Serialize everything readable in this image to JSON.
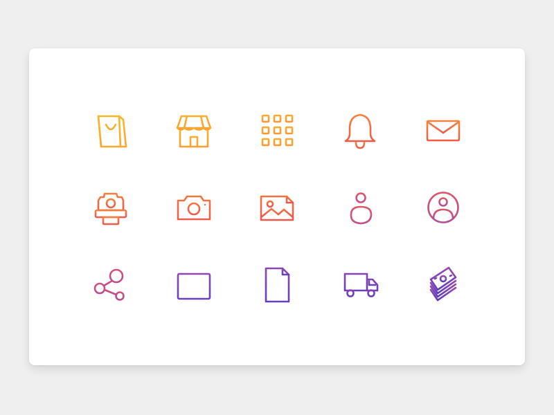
{
  "icons": [
    {
      "name": "shopping-bag-icon",
      "color_top": "#f9b62a",
      "color_bottom": "#f9a92d"
    },
    {
      "name": "store-icon",
      "color_top": "#f9b02c",
      "color_bottom": "#f8a12f"
    },
    {
      "name": "grid-icon",
      "color_top": "#f8ab2e",
      "color_bottom": "#f89a31"
    },
    {
      "name": "bell-icon",
      "color_top": "#f6823a",
      "color_bottom": "#ef5a48"
    },
    {
      "name": "mail-icon",
      "color_top": "#f5843a",
      "color_bottom": "#ee5c47"
    },
    {
      "name": "polaroid-camera-icon",
      "color_top": "#f37f3d",
      "color_bottom": "#ec5a4b"
    },
    {
      "name": "camera-icon",
      "color_top": "#f3763f",
      "color_bottom": "#ec5a4b"
    },
    {
      "name": "image-icon",
      "color_top": "#f27240",
      "color_bottom": "#ea574d"
    },
    {
      "name": "user-icon",
      "color_top": "#dd5664",
      "color_bottom": "#c24f86"
    },
    {
      "name": "user-circle-icon",
      "color_top": "#da5468",
      "color_bottom": "#b54f92"
    },
    {
      "name": "share-icon",
      "color_top": "#d2507a",
      "color_bottom": "#b74d8e"
    },
    {
      "name": "calendar-icon",
      "color_top": "#8f47ad",
      "color_bottom": "#6a3fb8"
    },
    {
      "name": "document-icon",
      "color_top": "#8a45b0",
      "color_bottom": "#673eb9"
    },
    {
      "name": "truck-icon",
      "color_top": "#8544b3",
      "color_bottom": "#693fb8"
    },
    {
      "name": "money-stack-icon",
      "color_top": "#9a49a8",
      "color_bottom": "#5d3cbc"
    }
  ]
}
